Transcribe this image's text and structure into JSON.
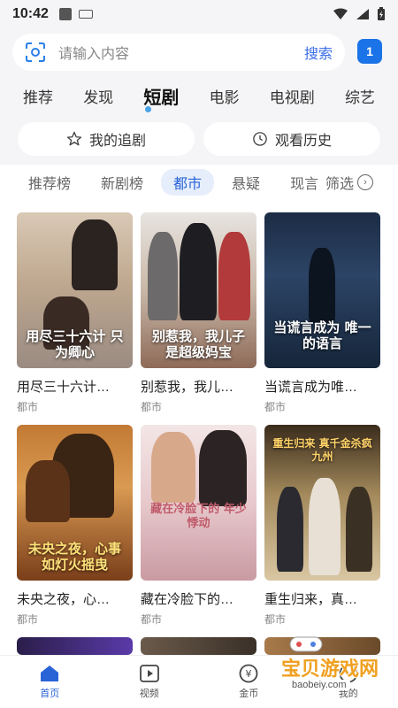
{
  "status_bar": {
    "time": "10:42"
  },
  "search": {
    "placeholder": "请输入内容",
    "button_label": "搜索",
    "message_count": "1"
  },
  "channel_tabs": [
    {
      "label": "推荐"
    },
    {
      "label": "发现"
    },
    {
      "label": "短剧"
    },
    {
      "label": "电影"
    },
    {
      "label": "电视剧"
    },
    {
      "label": "综艺"
    }
  ],
  "active_channel": "短剧",
  "quick_actions": {
    "follow_label": "我的追剧",
    "history_label": "观看历史"
  },
  "sub_tabs": [
    {
      "label": "推荐榜"
    },
    {
      "label": "新剧榜"
    },
    {
      "label": "都市"
    },
    {
      "label": "悬疑"
    },
    {
      "label": "现言"
    }
  ],
  "active_sub_tab": "都市",
  "filter_label": "筛选",
  "cards": [
    {
      "title": "用尽三十六计…",
      "tag": "都市",
      "poster_text": "用尽三十六计 只为卿心"
    },
    {
      "title": "别惹我，我儿…",
      "tag": "都市",
      "poster_text": "别惹我，我儿子是超级妈宝"
    },
    {
      "title": "当谎言成为唯…",
      "tag": "都市",
      "poster_text": "当谎言成为 唯一的语言"
    },
    {
      "title": "未央之夜，心…",
      "tag": "都市",
      "poster_text": "未央之夜，心事如灯火摇曳"
    },
    {
      "title": "藏在冷脸下的…",
      "tag": "都市",
      "poster_text": "藏在冷脸下的 年少悸动"
    },
    {
      "title": "重生归来，真…",
      "tag": "都市",
      "poster_text": "重生归来 真千金杀疯九州"
    }
  ],
  "bottom_nav": [
    {
      "label": "首页",
      "icon": "home-icon"
    },
    {
      "label": "视频",
      "icon": "play-icon"
    },
    {
      "label": "金币",
      "icon": "coin-icon"
    },
    {
      "label": "我的",
      "icon": "user-icon"
    }
  ],
  "watermark": {
    "title": "宝贝游戏网",
    "url": "baobeiy.com"
  },
  "colors": {
    "accent": "#2a63d6",
    "badge": "#1b73e8",
    "search_button": "#3a6ee8",
    "background_gray": "#f5f5f7"
  }
}
